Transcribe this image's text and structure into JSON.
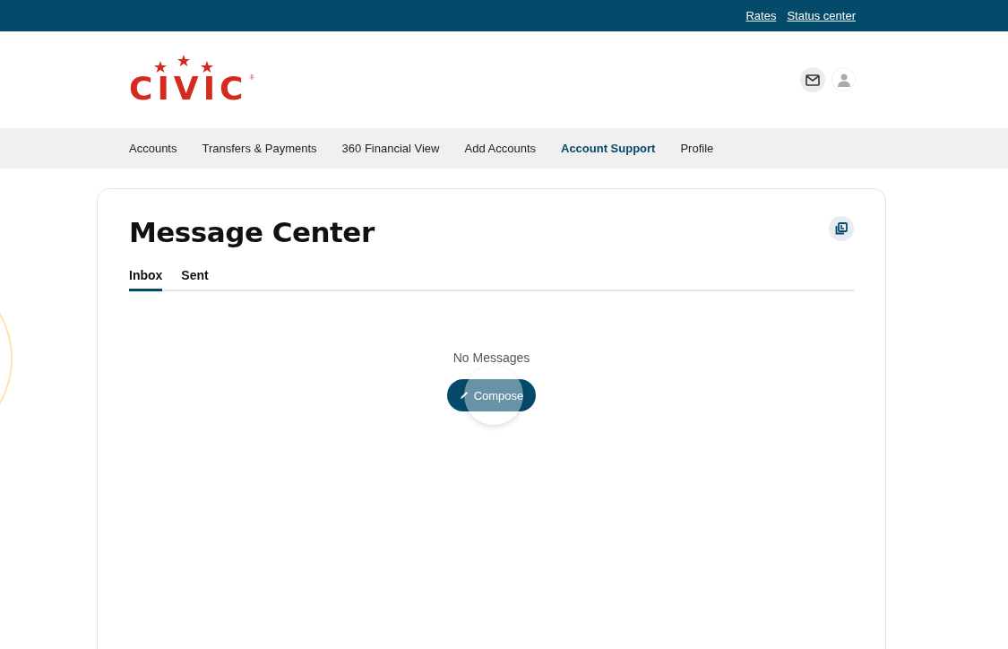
{
  "top_bar": {
    "links": [
      "Rates",
      "Status center"
    ]
  },
  "header": {
    "logo": {
      "text": "CIVIC",
      "mark": "®"
    }
  },
  "nav": {
    "items": [
      {
        "label": "Accounts",
        "selected": false
      },
      {
        "label": "Transfers & Payments",
        "selected": false
      },
      {
        "label": "360 Financial View",
        "selected": false
      },
      {
        "label": "Add Accounts",
        "selected": false
      },
      {
        "label": "Account Support",
        "selected": true
      },
      {
        "label": "Profile",
        "selected": false
      }
    ]
  },
  "message_center": {
    "title": "Message Center",
    "tabs": [
      {
        "label": "Inbox",
        "selected": true
      },
      {
        "label": "Sent",
        "selected": false
      }
    ],
    "empty_text": "No Messages",
    "compose_button": "Compose"
  }
}
